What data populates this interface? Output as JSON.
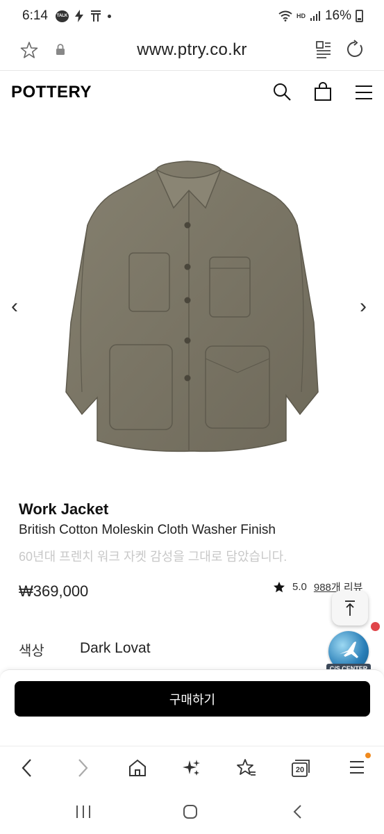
{
  "status_bar": {
    "time": "6:14",
    "talk_badge": "TALK",
    "network": "HD",
    "battery": "16%"
  },
  "browser": {
    "url": "www.ptry.co.kr"
  },
  "site": {
    "logo": "POTTERY"
  },
  "product": {
    "name": "Work Jacket",
    "subtitle": "British Cotton Moleskin Cloth Washer Finish",
    "description": "60년대 프렌치 워크 자켓 감성을 그대로 담았습니다.",
    "price": "₩369,000",
    "rating": "5.0",
    "review_link": "988개 리뷰",
    "color_label": "색상",
    "color_value": "Dark Lovat",
    "image_color": "#7a7565"
  },
  "carousel": {
    "prev": "‹",
    "next": "›"
  },
  "cs_center": {
    "label": "C/S CENTER"
  },
  "buy": {
    "label": "구매하기"
  },
  "browser_nav": {
    "tabs_count": "20"
  },
  "colors": {
    "accent": "#000000",
    "notice_dot": "#e0454a",
    "menu_dot": "#f08a1e"
  }
}
